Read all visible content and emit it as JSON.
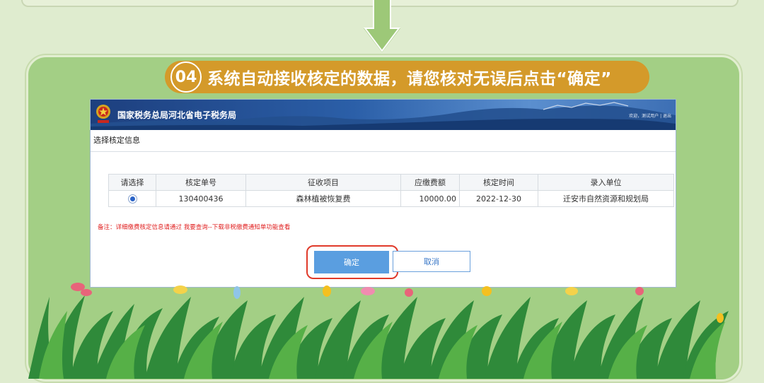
{
  "step": {
    "number": "04",
    "text": "系统自动接收核定的数据，请您核对无误后点击“确定”"
  },
  "window": {
    "site_title": "国家税务总局河北省电子税务局",
    "user_info": "欢迎，测试用户 | 退出",
    "section_title": "选择核定信息"
  },
  "table": {
    "headers": [
      "请选择",
      "核定单号",
      "征收项目",
      "应缴费额",
      "核定时间",
      "录入单位"
    ],
    "rows": [
      {
        "selected": true,
        "id": "130400436",
        "item": "森林植被恢复费",
        "amount": "10000.00",
        "date": "2022-12-30",
        "unit": "迁安市自然资源和规划局"
      }
    ]
  },
  "note": "备注：详细缴费核定信息请通过 我要查询--下载非税缴费通知单功能查看",
  "buttons": {
    "confirm": "确定",
    "cancel": "取消"
  },
  "colors": {
    "background": "#dfeccf",
    "panel": "#a3cf85",
    "banner": "#d49a2a",
    "header": "#2b5fa8",
    "confirm": "#5a9ee0",
    "highlight": "#e03a2a",
    "note": "#e02020"
  }
}
